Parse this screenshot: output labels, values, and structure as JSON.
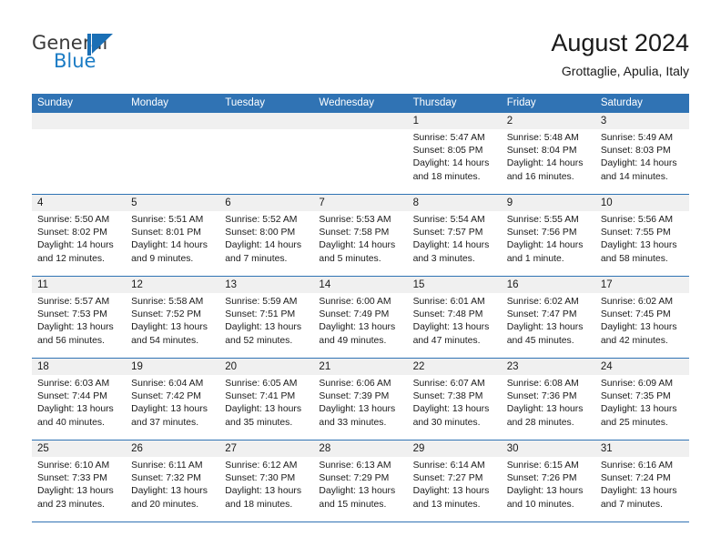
{
  "logo": {
    "text_top": "General",
    "text_bottom": "Blue",
    "mark": "triangle-mark"
  },
  "header": {
    "title": "August 2024",
    "subtitle": "Grottaglie, Apulia, Italy"
  },
  "colors": {
    "header_blue": "#3073b4",
    "daynum_band": "#f0f0f0",
    "logo_blue": "#1a7bc4",
    "logo_gray": "#3a3a3a"
  },
  "weekdays": [
    "Sunday",
    "Monday",
    "Tuesday",
    "Wednesday",
    "Thursday",
    "Friday",
    "Saturday"
  ],
  "weeks": [
    [
      {
        "day": "",
        "lines": []
      },
      {
        "day": "",
        "lines": []
      },
      {
        "day": "",
        "lines": []
      },
      {
        "day": "",
        "lines": []
      },
      {
        "day": "1",
        "lines": [
          "Sunrise: 5:47 AM",
          "Sunset: 8:05 PM",
          "Daylight: 14 hours",
          "and 18 minutes."
        ]
      },
      {
        "day": "2",
        "lines": [
          "Sunrise: 5:48 AM",
          "Sunset: 8:04 PM",
          "Daylight: 14 hours",
          "and 16 minutes."
        ]
      },
      {
        "day": "3",
        "lines": [
          "Sunrise: 5:49 AM",
          "Sunset: 8:03 PM",
          "Daylight: 14 hours",
          "and 14 minutes."
        ]
      }
    ],
    [
      {
        "day": "4",
        "lines": [
          "Sunrise: 5:50 AM",
          "Sunset: 8:02 PM",
          "Daylight: 14 hours",
          "and 12 minutes."
        ]
      },
      {
        "day": "5",
        "lines": [
          "Sunrise: 5:51 AM",
          "Sunset: 8:01 PM",
          "Daylight: 14 hours",
          "and 9 minutes."
        ]
      },
      {
        "day": "6",
        "lines": [
          "Sunrise: 5:52 AM",
          "Sunset: 8:00 PM",
          "Daylight: 14 hours",
          "and 7 minutes."
        ]
      },
      {
        "day": "7",
        "lines": [
          "Sunrise: 5:53 AM",
          "Sunset: 7:58 PM",
          "Daylight: 14 hours",
          "and 5 minutes."
        ]
      },
      {
        "day": "8",
        "lines": [
          "Sunrise: 5:54 AM",
          "Sunset: 7:57 PM",
          "Daylight: 14 hours",
          "and 3 minutes."
        ]
      },
      {
        "day": "9",
        "lines": [
          "Sunrise: 5:55 AM",
          "Sunset: 7:56 PM",
          "Daylight: 14 hours",
          "and 1 minute."
        ]
      },
      {
        "day": "10",
        "lines": [
          "Sunrise: 5:56 AM",
          "Sunset: 7:55 PM",
          "Daylight: 13 hours",
          "and 58 minutes."
        ]
      }
    ],
    [
      {
        "day": "11",
        "lines": [
          "Sunrise: 5:57 AM",
          "Sunset: 7:53 PM",
          "Daylight: 13 hours",
          "and 56 minutes."
        ]
      },
      {
        "day": "12",
        "lines": [
          "Sunrise: 5:58 AM",
          "Sunset: 7:52 PM",
          "Daylight: 13 hours",
          "and 54 minutes."
        ]
      },
      {
        "day": "13",
        "lines": [
          "Sunrise: 5:59 AM",
          "Sunset: 7:51 PM",
          "Daylight: 13 hours",
          "and 52 minutes."
        ]
      },
      {
        "day": "14",
        "lines": [
          "Sunrise: 6:00 AM",
          "Sunset: 7:49 PM",
          "Daylight: 13 hours",
          "and 49 minutes."
        ]
      },
      {
        "day": "15",
        "lines": [
          "Sunrise: 6:01 AM",
          "Sunset: 7:48 PM",
          "Daylight: 13 hours",
          "and 47 minutes."
        ]
      },
      {
        "day": "16",
        "lines": [
          "Sunrise: 6:02 AM",
          "Sunset: 7:47 PM",
          "Daylight: 13 hours",
          "and 45 minutes."
        ]
      },
      {
        "day": "17",
        "lines": [
          "Sunrise: 6:02 AM",
          "Sunset: 7:45 PM",
          "Daylight: 13 hours",
          "and 42 minutes."
        ]
      }
    ],
    [
      {
        "day": "18",
        "lines": [
          "Sunrise: 6:03 AM",
          "Sunset: 7:44 PM",
          "Daylight: 13 hours",
          "and 40 minutes."
        ]
      },
      {
        "day": "19",
        "lines": [
          "Sunrise: 6:04 AM",
          "Sunset: 7:42 PM",
          "Daylight: 13 hours",
          "and 37 minutes."
        ]
      },
      {
        "day": "20",
        "lines": [
          "Sunrise: 6:05 AM",
          "Sunset: 7:41 PM",
          "Daylight: 13 hours",
          "and 35 minutes."
        ]
      },
      {
        "day": "21",
        "lines": [
          "Sunrise: 6:06 AM",
          "Sunset: 7:39 PM",
          "Daylight: 13 hours",
          "and 33 minutes."
        ]
      },
      {
        "day": "22",
        "lines": [
          "Sunrise: 6:07 AM",
          "Sunset: 7:38 PM",
          "Daylight: 13 hours",
          "and 30 minutes."
        ]
      },
      {
        "day": "23",
        "lines": [
          "Sunrise: 6:08 AM",
          "Sunset: 7:36 PM",
          "Daylight: 13 hours",
          "and 28 minutes."
        ]
      },
      {
        "day": "24",
        "lines": [
          "Sunrise: 6:09 AM",
          "Sunset: 7:35 PM",
          "Daylight: 13 hours",
          "and 25 minutes."
        ]
      }
    ],
    [
      {
        "day": "25",
        "lines": [
          "Sunrise: 6:10 AM",
          "Sunset: 7:33 PM",
          "Daylight: 13 hours",
          "and 23 minutes."
        ]
      },
      {
        "day": "26",
        "lines": [
          "Sunrise: 6:11 AM",
          "Sunset: 7:32 PM",
          "Daylight: 13 hours",
          "and 20 minutes."
        ]
      },
      {
        "day": "27",
        "lines": [
          "Sunrise: 6:12 AM",
          "Sunset: 7:30 PM",
          "Daylight: 13 hours",
          "and 18 minutes."
        ]
      },
      {
        "day": "28",
        "lines": [
          "Sunrise: 6:13 AM",
          "Sunset: 7:29 PM",
          "Daylight: 13 hours",
          "and 15 minutes."
        ]
      },
      {
        "day": "29",
        "lines": [
          "Sunrise: 6:14 AM",
          "Sunset: 7:27 PM",
          "Daylight: 13 hours",
          "and 13 minutes."
        ]
      },
      {
        "day": "30",
        "lines": [
          "Sunrise: 6:15 AM",
          "Sunset: 7:26 PM",
          "Daylight: 13 hours",
          "and 10 minutes."
        ]
      },
      {
        "day": "31",
        "lines": [
          "Sunrise: 6:16 AM",
          "Sunset: 7:24 PM",
          "Daylight: 13 hours",
          "and 7 minutes."
        ]
      }
    ]
  ]
}
